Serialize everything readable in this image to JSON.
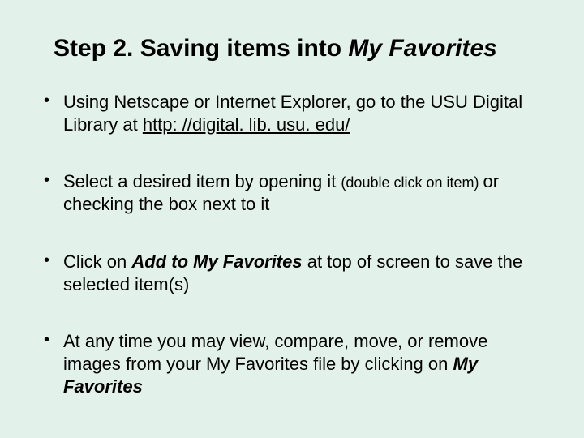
{
  "title": {
    "prefix": "Step 2.  Saving items into ",
    "emphasis": "My Favorites"
  },
  "bullets": {
    "b1": {
      "p1": "Using Netscape or Internet Explorer, go to the USU Digital Library at ",
      "link": "http: //digital. lib. usu. edu/"
    },
    "b2": {
      "p1": "Select a desired item by opening it ",
      "small": "(double click on item) ",
      "p2": "or checking the box next to it"
    },
    "b3": {
      "p1": "Click on ",
      "em": "Add to My Favorites",
      "p2": " at top of screen to save the selected item(s)"
    },
    "b4": {
      "p1": "At any time you may view, compare, move, or remove images from your My Favorites file by clicking on ",
      "em": "My Favorites"
    }
  }
}
